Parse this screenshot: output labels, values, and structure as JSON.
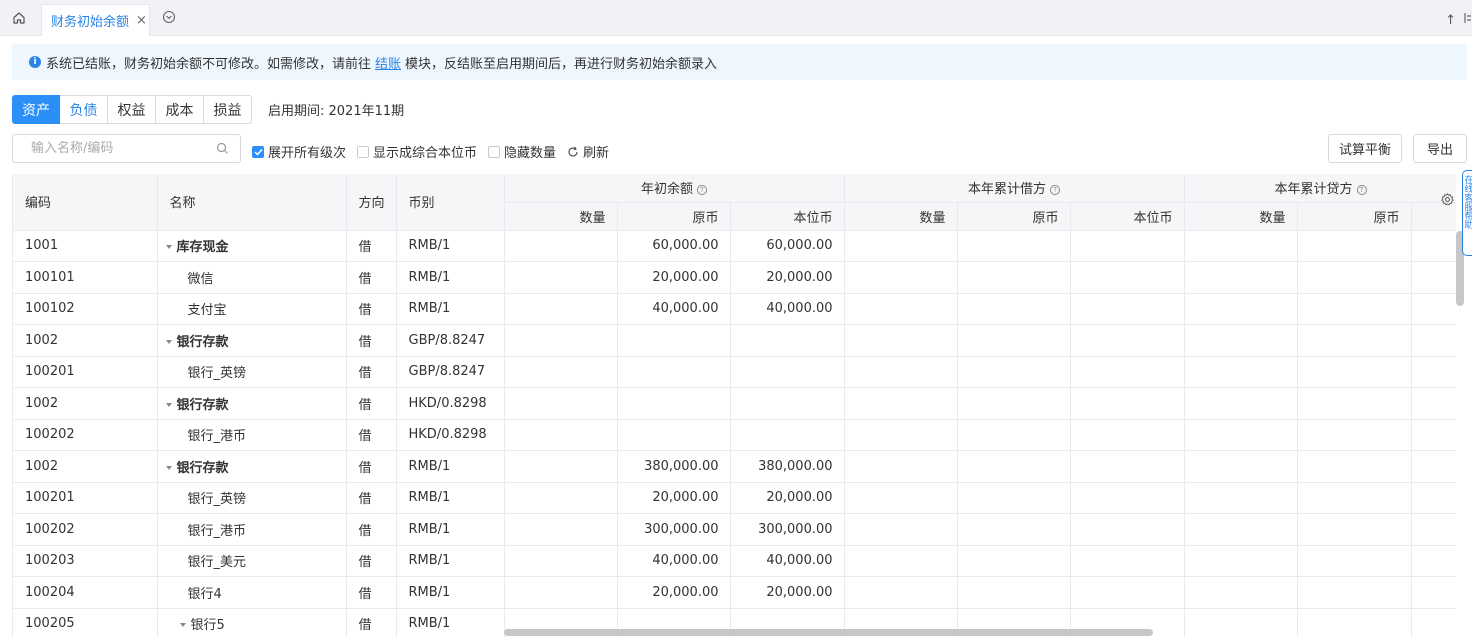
{
  "tabs": {
    "active_tab": "财务初始余额",
    "close": "×"
  },
  "top_right": {
    "up": "↑"
  },
  "banner": {
    "text_before": "系统已结账，财务初始余额不可修改。如需修改，请前往",
    "link": "结账",
    "text_after": "模块，反结账至启用期间后，再进行财务初始余额录入"
  },
  "categories": [
    "资产",
    "负债",
    "权益",
    "成本",
    "损益"
  ],
  "period": "启用期间: 2021年11期",
  "search": {
    "placeholder": "输入名称/编码"
  },
  "options": {
    "expand_all": "展开所有级次",
    "show_local": "显示成综合本位币",
    "hide_qty": "隐藏数量",
    "refresh": "刷新"
  },
  "buttons": {
    "trial": "试算平衡",
    "export": "导出"
  },
  "side_help": "在线客服帮助",
  "table": {
    "headers": {
      "code": "编码",
      "name": "名称",
      "direction": "方向",
      "currency": "币别",
      "opening": "年初余额",
      "debit": "本年累计借方",
      "credit": "本年累计贷方",
      "qty": "数量",
      "orig": "原币",
      "local": "本位币"
    },
    "rows": [
      {
        "code": "1001",
        "name": "库存现金",
        "level": "parent",
        "dir": "借",
        "cur": "RMB/1",
        "qty": "",
        "orig": "60,000.00",
        "local": "60,000.00"
      },
      {
        "code": "100101",
        "name": "微信",
        "level": "child",
        "dir": "借",
        "cur": "RMB/1",
        "qty": "",
        "orig": "20,000.00",
        "local": "20,000.00"
      },
      {
        "code": "100102",
        "name": "支付宝",
        "level": "child",
        "dir": "借",
        "cur": "RMB/1",
        "qty": "",
        "orig": "40,000.00",
        "local": "40,000.00"
      },
      {
        "code": "1002",
        "name": "银行存款",
        "level": "parent",
        "dir": "借",
        "cur": "GBP/8.8247",
        "qty": "",
        "orig": "",
        "local": ""
      },
      {
        "code": "100201",
        "name": "银行_英镑",
        "level": "child",
        "dir": "借",
        "cur": "GBP/8.8247",
        "qty": "",
        "orig": "",
        "local": ""
      },
      {
        "code": "1002",
        "name": "银行存款",
        "level": "parent",
        "dir": "借",
        "cur": "HKD/0.8298",
        "qty": "",
        "orig": "",
        "local": ""
      },
      {
        "code": "100202",
        "name": "银行_港币",
        "level": "child",
        "dir": "借",
        "cur": "HKD/0.8298",
        "qty": "",
        "orig": "",
        "local": ""
      },
      {
        "code": "1002",
        "name": "银行存款",
        "level": "parent",
        "dir": "借",
        "cur": "RMB/1",
        "qty": "",
        "orig": "380,000.00",
        "local": "380,000.00"
      },
      {
        "code": "100201",
        "name": "银行_英镑",
        "level": "child",
        "dir": "借",
        "cur": "RMB/1",
        "qty": "",
        "orig": "20,000.00",
        "local": "20,000.00"
      },
      {
        "code": "100202",
        "name": "银行_港币",
        "level": "child",
        "dir": "借",
        "cur": "RMB/1",
        "qty": "",
        "orig": "300,000.00",
        "local": "300,000.00"
      },
      {
        "code": "100203",
        "name": "银行_美元",
        "level": "child",
        "dir": "借",
        "cur": "RMB/1",
        "qty": "",
        "orig": "40,000.00",
        "local": "40,000.00"
      },
      {
        "code": "100204",
        "name": "银行4",
        "level": "child",
        "dir": "借",
        "cur": "RMB/1",
        "qty": "",
        "orig": "20,000.00",
        "local": "20,000.00"
      },
      {
        "code": "100205",
        "name": "银行5",
        "level": "sub",
        "dir": "借",
        "cur": "RMB/1",
        "qty": "",
        "orig": "",
        "local": ""
      }
    ]
  },
  "colors": {
    "accent": "#2a8ff7",
    "link": "#2a84e8",
    "banner_bg": "#eef6fe",
    "header_bg": "#f5f6f8"
  }
}
